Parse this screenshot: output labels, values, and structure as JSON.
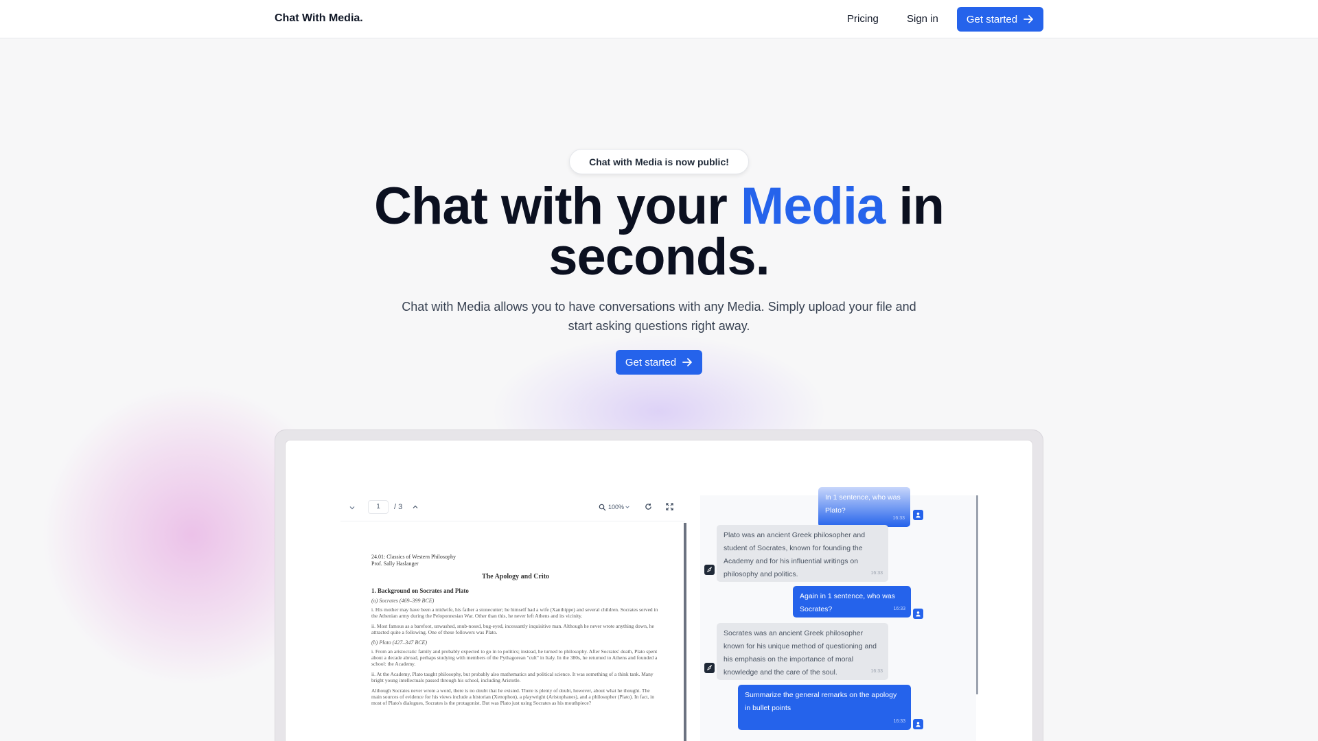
{
  "nav": {
    "brand": "Chat With Media.",
    "pricing": "Pricing",
    "sign_in": "Sign in",
    "cta": "Get started"
  },
  "hero": {
    "badge": "Chat with Media is now public!",
    "headline_part1": "Chat with your ",
    "headline_accent": "Media",
    "headline_part2": " in seconds.",
    "subtext": "Chat with Media allows you to have conversations with any Media. Simply upload your file and start asking questions right away.",
    "cta": "Get started"
  },
  "colors": {
    "accent": "#2563eb",
    "glow_pink": "#e296dc",
    "glow_violet": "#bea5f5"
  },
  "pdf_viewer": {
    "page_current": "1",
    "page_total": "/ 3",
    "zoom": "100%",
    "doc": {
      "header_line1": "24.01: Classics of Western Philosophy",
      "header_line2": "Prof. Sally Haslanger",
      "title": "The Apology and Crito",
      "section": "1.  Background on Socrates and Plato",
      "sub_a": "(a) Socrates (469–399 BCE)",
      "para_1": "i. His mother may have been a midwife, his father a stonecutter; he himself had a wife (Xanthippe) and several children. Socrates served in the Athenian army during the Peloponnesian War. Other than this, he never left Athens and its vicinity.",
      "para_2": "ii. Most famous as a barefoot, unwashed, snub-nosed, bug-eyed, incessantly inquisitive man. Although he never wrote anything down, he attracted quite a following. One of these followers was Plato.",
      "sub_b": "(b) Plato (427–347 BCE)",
      "para_3": "i. From an aristocratic family and probably expected to go in to politics; instead, he turned to philosophy. After Socrates' death, Plato spent about a decade abroad, perhaps studying with members of the Pythagorean \"cult\" in Italy. In the 380s, he returned to Athens and founded a school: the Academy.",
      "para_4": "ii. At the Academy, Plato taught philosophy, but probably also mathematics and political science. It was something of a think tank. Many bright young intellectuals passed through his school, including Aristotle.",
      "para_5": "Although Socrates never wrote a word, there is no doubt that he existed. There is plenty of doubt, however, about what he thought. The main sources of evidence for his views include a historian (Xenophon), a playwright (Aristophanes), and a philosopher (Plato). In fact, in most of Plato's dialogues, Socrates is the protagonist. But was Plato just using Socrates as his mouthpiece?"
    }
  },
  "chat": {
    "messages": [
      {
        "role": "user",
        "text": "In 1 sentence, who was Plato?",
        "time": "16:33"
      },
      {
        "role": "bot",
        "text": "Plato was an ancient Greek philosopher and student of Socrates, known for founding the Academy and for his influential writings on philosophy and politics.",
        "time": "16:33"
      },
      {
        "role": "user",
        "text": "Again in 1 sentence, who was Socrates?",
        "time": "16:33"
      },
      {
        "role": "bot",
        "text": "Socrates was an ancient Greek philosopher known for his unique method of questioning and his emphasis on the importance of moral knowledge and the care of the soul.",
        "time": "16:33"
      },
      {
        "role": "user",
        "text": "Summarize the general remarks on the apology in bullet points",
        "time": "16:33"
      }
    ]
  }
}
